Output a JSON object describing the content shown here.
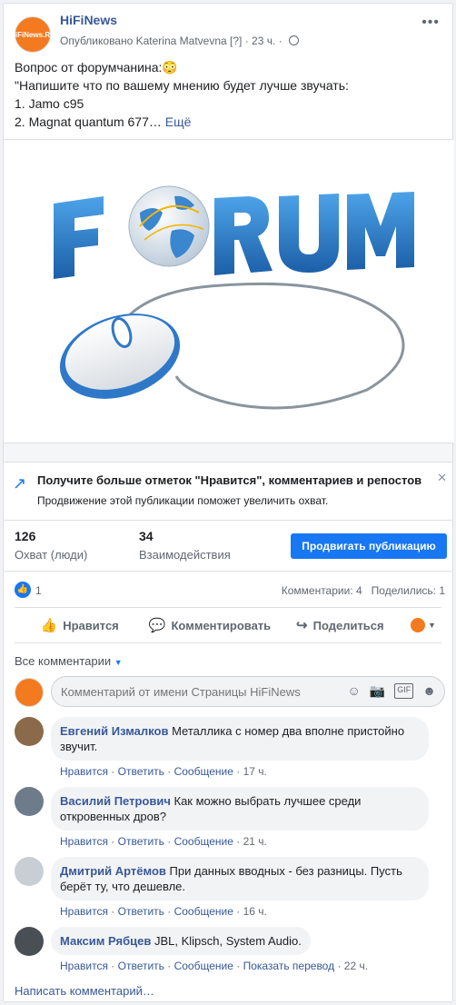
{
  "post": {
    "page_name": "HiFiNews",
    "avatar_text": "HiFiNews.RU",
    "published_prefix": "Опубликовано",
    "published_by": "Katerina Matvevna",
    "marker": "[?]",
    "time": "23 ч.",
    "text_lines": [
      "Вопрос от форумчанина:😳",
      "\"Напишите что по вашему мнению будет лучше звучать:",
      "1. Jamo c95",
      "2. Magnat quantum 677…"
    ],
    "more_label": "Ещё",
    "image_title": "FORUM"
  },
  "promo": {
    "title": "Получите больше отметок \"Нравится\", комментариев и репостов",
    "subtitle": "Продвижение этой публикации поможет увеличить охват."
  },
  "stats": {
    "reach_value": "126",
    "reach_label": "Охват (люди)",
    "engagement_value": "34",
    "engagement_label": "Взаимодействия",
    "boost_label": "Продвигать публикацию"
  },
  "reactions": {
    "count": "1",
    "comments": "Комментарии: 4",
    "shares": "Поделились: 1"
  },
  "actions": {
    "like": "Нравится",
    "comment": "Комментировать",
    "share": "Поделиться"
  },
  "comments_section": {
    "filter_label": "Все комментарии",
    "composer_placeholder": "Комментарий от имени Страницы HiFiNews",
    "write_comment": "Написать комментарий…"
  },
  "comment_action_labels": {
    "like": "Нравится",
    "reply": "Ответить",
    "message": "Сообщение",
    "translate": "Показать перевод"
  },
  "comments": [
    {
      "author": "Евгений Измалков",
      "line1": "Металлика с номер два вполне пристойно",
      "line2": "звучит.",
      "time": "17 ч."
    },
    {
      "author": "Василий Петрович",
      "line1": "Как можно выбрать лучшее среди",
      "line2": "откровенных дров?",
      "time": "21 ч."
    },
    {
      "author": "Дмитрий Артёмов",
      "line1": "При данных вводных - без разницы. Пусть",
      "line2": "берёт ту, что дешевле.",
      "time": "16 ч."
    },
    {
      "author": "Максим Рябцев",
      "line1": "JBL, Klipsch, System Audio.",
      "line2": "",
      "time": "22 ч."
    }
  ],
  "colors": {
    "brand_blue": "#1877f2",
    "link_blue": "#385898",
    "avatar_orange": "#f37a1f"
  }
}
